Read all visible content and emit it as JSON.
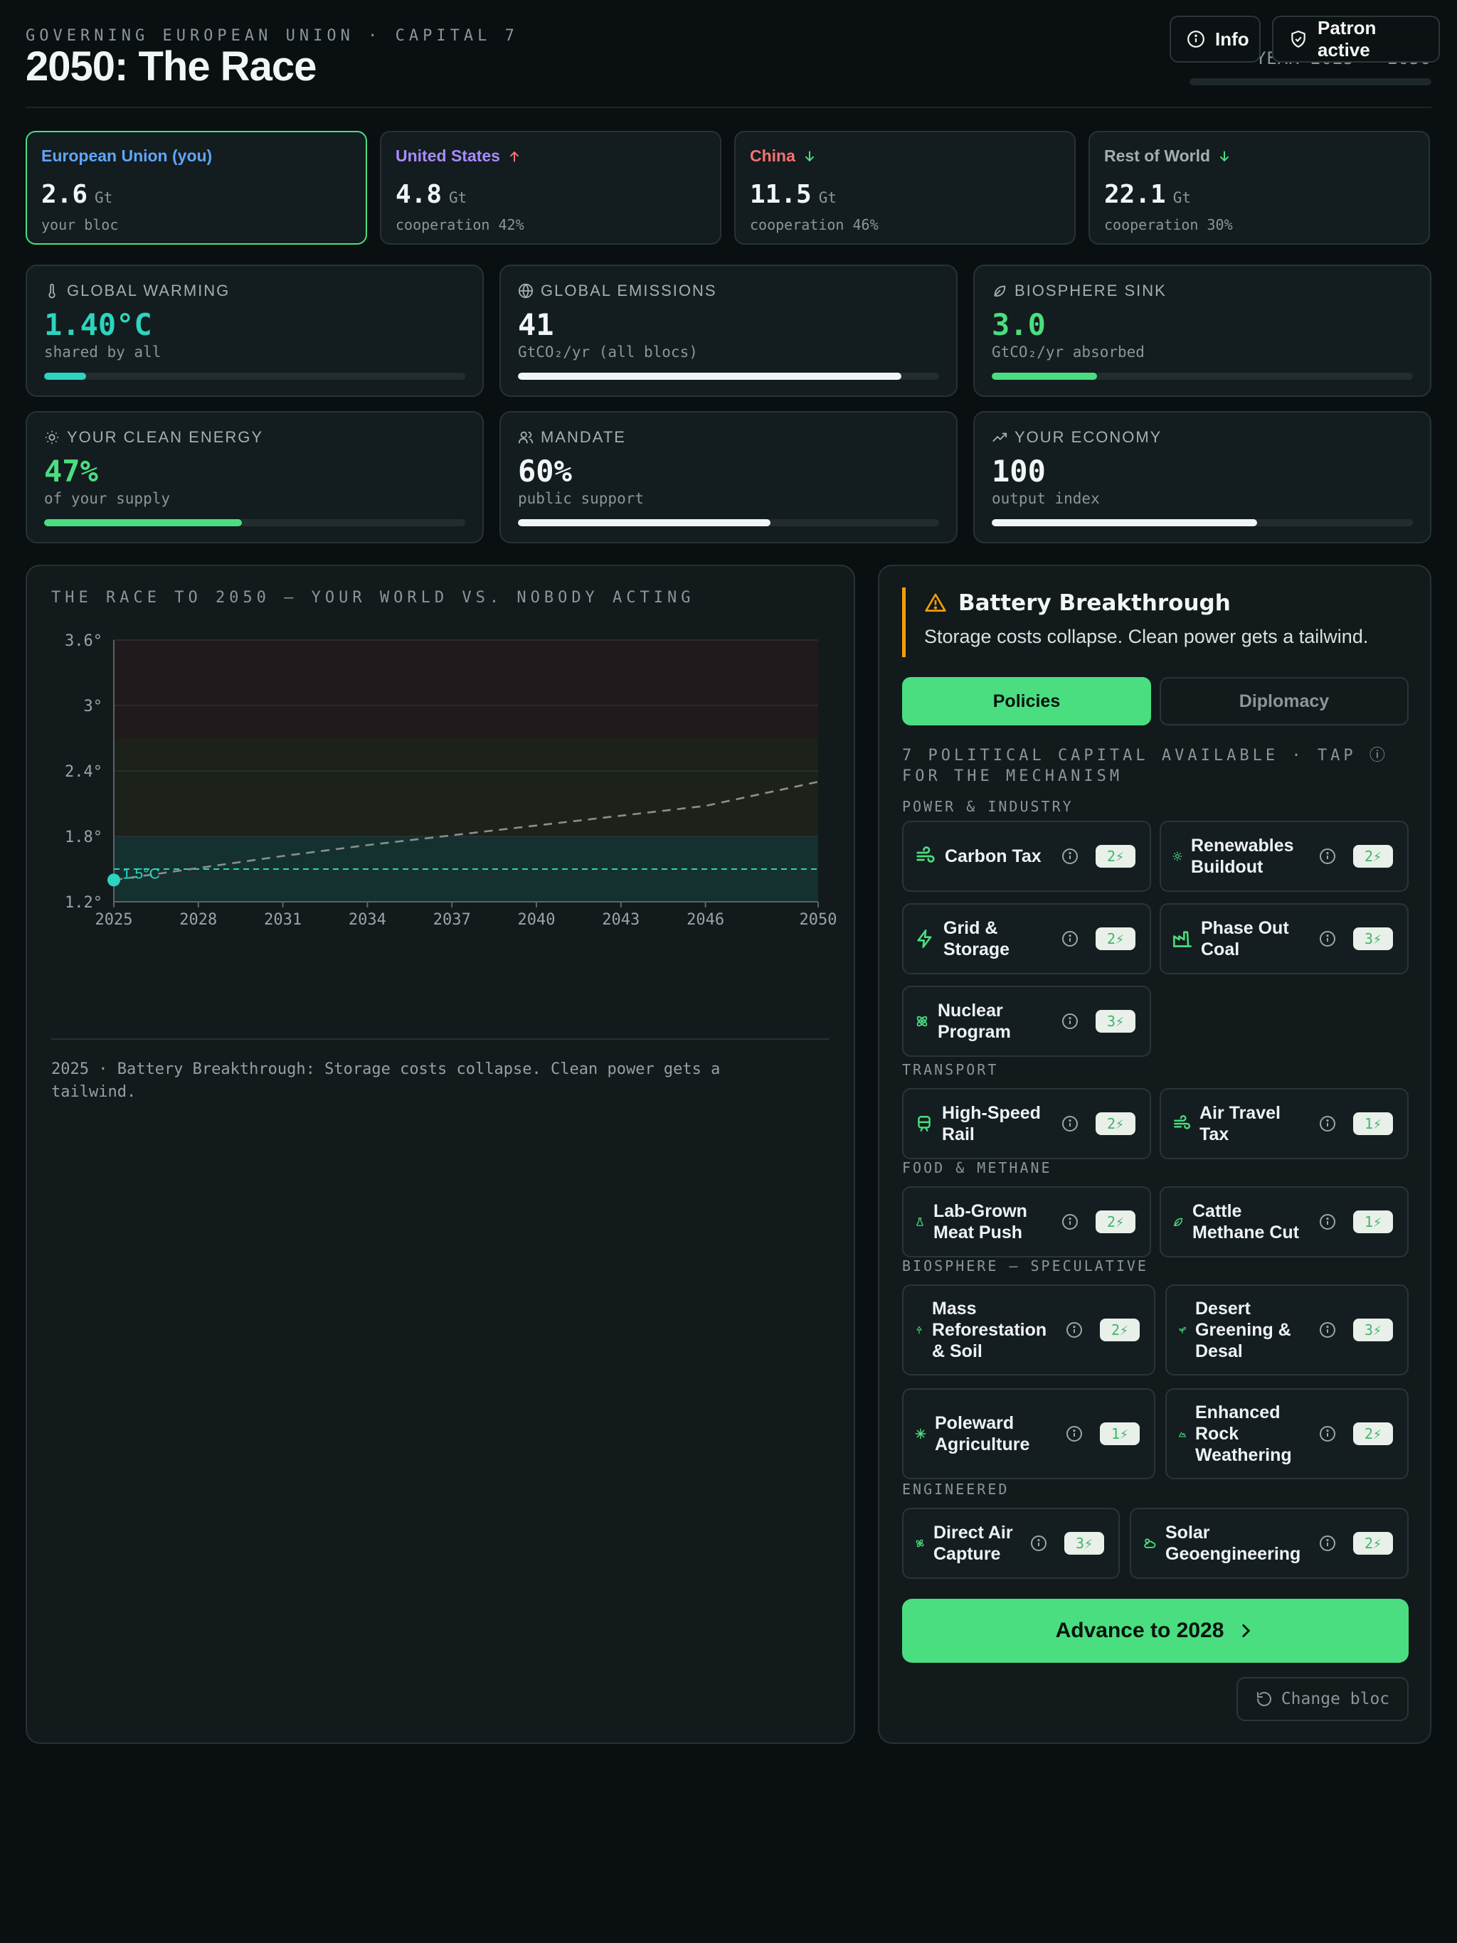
{
  "header": {
    "eyebrow": "GOVERNING EUROPEAN UNION · CAPITAL 7",
    "title": "2050: The Race",
    "year_label": "YEAR 2025 → 2050",
    "info_label": "Info",
    "patron_label": "Patron active"
  },
  "blocs": [
    {
      "name": "European Union (you)",
      "value": "2.6",
      "unit": "Gt",
      "sub": "your bloc",
      "color": "#60a5fa",
      "trend": "none"
    },
    {
      "name": "United States",
      "value": "4.8",
      "unit": "Gt",
      "sub": "cooperation 42%",
      "color": "#a78bfa",
      "trend": "up"
    },
    {
      "name": "China",
      "value": "11.5",
      "unit": "Gt",
      "sub": "cooperation 46%",
      "color": "#f87171",
      "trend": "down"
    },
    {
      "name": "Rest of World",
      "value": "22.1",
      "unit": "Gt",
      "sub": "cooperation 30%",
      "color": "#a3aeb1",
      "trend": "down"
    }
  ],
  "stats": {
    "warming": {
      "label": "GLOBAL WARMING",
      "value": "1.40°C",
      "caption": "shared by all",
      "progress": 0.1,
      "icon": "thermometer-icon",
      "color": "#2dd4bf"
    },
    "emissions": {
      "label": "GLOBAL EMISSIONS",
      "value": "41",
      "caption": "GtCO₂/yr (all blocs)",
      "progress": 0.91,
      "icon": "globe-icon",
      "color": "#f2f5f6"
    },
    "sink": {
      "label": "BIOSPHERE SINK",
      "value": "3.0",
      "caption": "GtCO₂/yr absorbed",
      "progress": 0.25,
      "icon": "leaf-icon",
      "color": "#4ade80"
    },
    "clean": {
      "label": "YOUR CLEAN ENERGY",
      "value": "47%",
      "caption": "of your supply",
      "progress": 0.47,
      "icon": "sun-icon",
      "color": "#4ade80"
    },
    "mandate": {
      "label": "MANDATE",
      "value": "60%",
      "caption": "public support",
      "progress": 0.6,
      "icon": "users-icon",
      "color": "#f2f5f6"
    },
    "economy": {
      "label": "YOUR ECONOMY",
      "value": "100",
      "caption": "output index",
      "progress": 0.63,
      "icon": "trending-up-icon",
      "color": "#f2f5f6"
    }
  },
  "chart": {
    "title": "THE RACE TO 2050 — YOUR WORLD VS. NOBODY ACTING",
    "caption": "2025 · Battery Breakthrough: Storage costs collapse. Clean power gets a tailwind.",
    "threshold_label": "1.5°C"
  },
  "chart_data": {
    "type": "line",
    "title": "THE RACE TO 2050 — YOUR WORLD VS. NOBODY ACTING",
    "xlabel": "",
    "ylabel": "",
    "xlim": [
      2025,
      2050
    ],
    "ylim": [
      1.2,
      3.6
    ],
    "x_ticks": [
      2025,
      2028,
      2031,
      2034,
      2037,
      2040,
      2043,
      2046,
      2050
    ],
    "y_ticks": [
      1.2,
      1.8,
      2.4,
      3.0,
      3.6
    ],
    "y_tick_labels": [
      "1.2°",
      "1.8°",
      "2.4°",
      "3°",
      "3.6°"
    ],
    "grid": true,
    "bands": [
      {
        "from": 1.2,
        "to": 1.8,
        "color": "#15312f"
      },
      {
        "from": 1.8,
        "to": 2.7,
        "color": "#1c2119"
      },
      {
        "from": 2.7,
        "to": 3.6,
        "color": "#201a1c"
      }
    ],
    "threshold": {
      "value": 1.5,
      "label": "1.5°C",
      "color": "#2dd4bf"
    },
    "series": [
      {
        "style": "dashed",
        "color": "#8a8f8c",
        "x": [
          2025,
          2028,
          2031,
          2034,
          2037,
          2040,
          2043,
          2046,
          2050
        ],
        "values": [
          1.4,
          1.51,
          1.62,
          1.72,
          1.81,
          1.9,
          1.99,
          2.08,
          2.3
        ]
      },
      {
        "style": "point",
        "color": "#2dd4bf",
        "x": [
          2025
        ],
        "values": [
          1.4
        ]
      }
    ]
  },
  "event": {
    "title": "Battery Breakthrough",
    "description": "Storage costs collapse. Clean power gets a tailwind."
  },
  "tabs": {
    "policies": "Policies",
    "diplomacy": "Diplomacy"
  },
  "capital_note": "7 POLITICAL CAPITAL AVAILABLE · TAP ⓘ FOR THE MECHANISM",
  "policy_sections": {
    "power": "POWER & INDUSTRY",
    "transport": "TRANSPORT",
    "food": "FOOD & METHANE",
    "biosphere": "BIOSPHERE — SPECULATIVE",
    "engineered": "ENGINEERED"
  },
  "policies": {
    "carbon_tax": {
      "name": "Carbon Tax",
      "cost": "2⚡",
      "icon": "carbon-tax-icon"
    },
    "renewables": {
      "name": "Renewables Buildout",
      "cost": "2⚡",
      "icon": "sun-icon"
    },
    "grid": {
      "name": "Grid & Storage",
      "cost": "2⚡",
      "icon": "bolt-icon"
    },
    "coal": {
      "name": "Phase Out Coal",
      "cost": "3⚡",
      "icon": "factory-icon"
    },
    "nuclear": {
      "name": "Nuclear Program",
      "cost": "3⚡",
      "icon": "atom-icon"
    },
    "rail": {
      "name": "High-Speed Rail",
      "cost": "2⚡",
      "icon": "train-icon"
    },
    "air": {
      "name": "Air Travel Tax",
      "cost": "1⚡",
      "icon": "wind-icon"
    },
    "meat": {
      "name": "Lab-Grown Meat Push",
      "cost": "2⚡",
      "icon": "flask-icon"
    },
    "cattle": {
      "name": "Cattle Methane Cut",
      "cost": "1⚡",
      "icon": "leaf-icon"
    },
    "reforest": {
      "name": "Mass Reforestation & Soil",
      "cost": "2⚡",
      "icon": "tree-icon"
    },
    "desert": {
      "name": "Desert Greening & Desal",
      "cost": "3⚡",
      "icon": "sprout-icon"
    },
    "poleward": {
      "name": "Poleward Agriculture",
      "cost": "1⚡",
      "icon": "snowflake-icon"
    },
    "rock": {
      "name": "Enhanced Rock Weathering",
      "cost": "2⚡",
      "icon": "mountain-icon"
    },
    "dac": {
      "name": "Direct Air Capture",
      "cost": "3⚡",
      "icon": "fan-icon"
    },
    "solar_geo": {
      "name": "Solar Geoengineering",
      "cost": "2⚡",
      "icon": "cloud-sun-icon"
    }
  },
  "advance_label": "Advance to 2028",
  "change_bloc_label": "Change bloc",
  "colors": {
    "accent": "#4ade80",
    "warning": "#f59e0b",
    "teal": "#2dd4bf",
    "background": "#0a0f11"
  }
}
